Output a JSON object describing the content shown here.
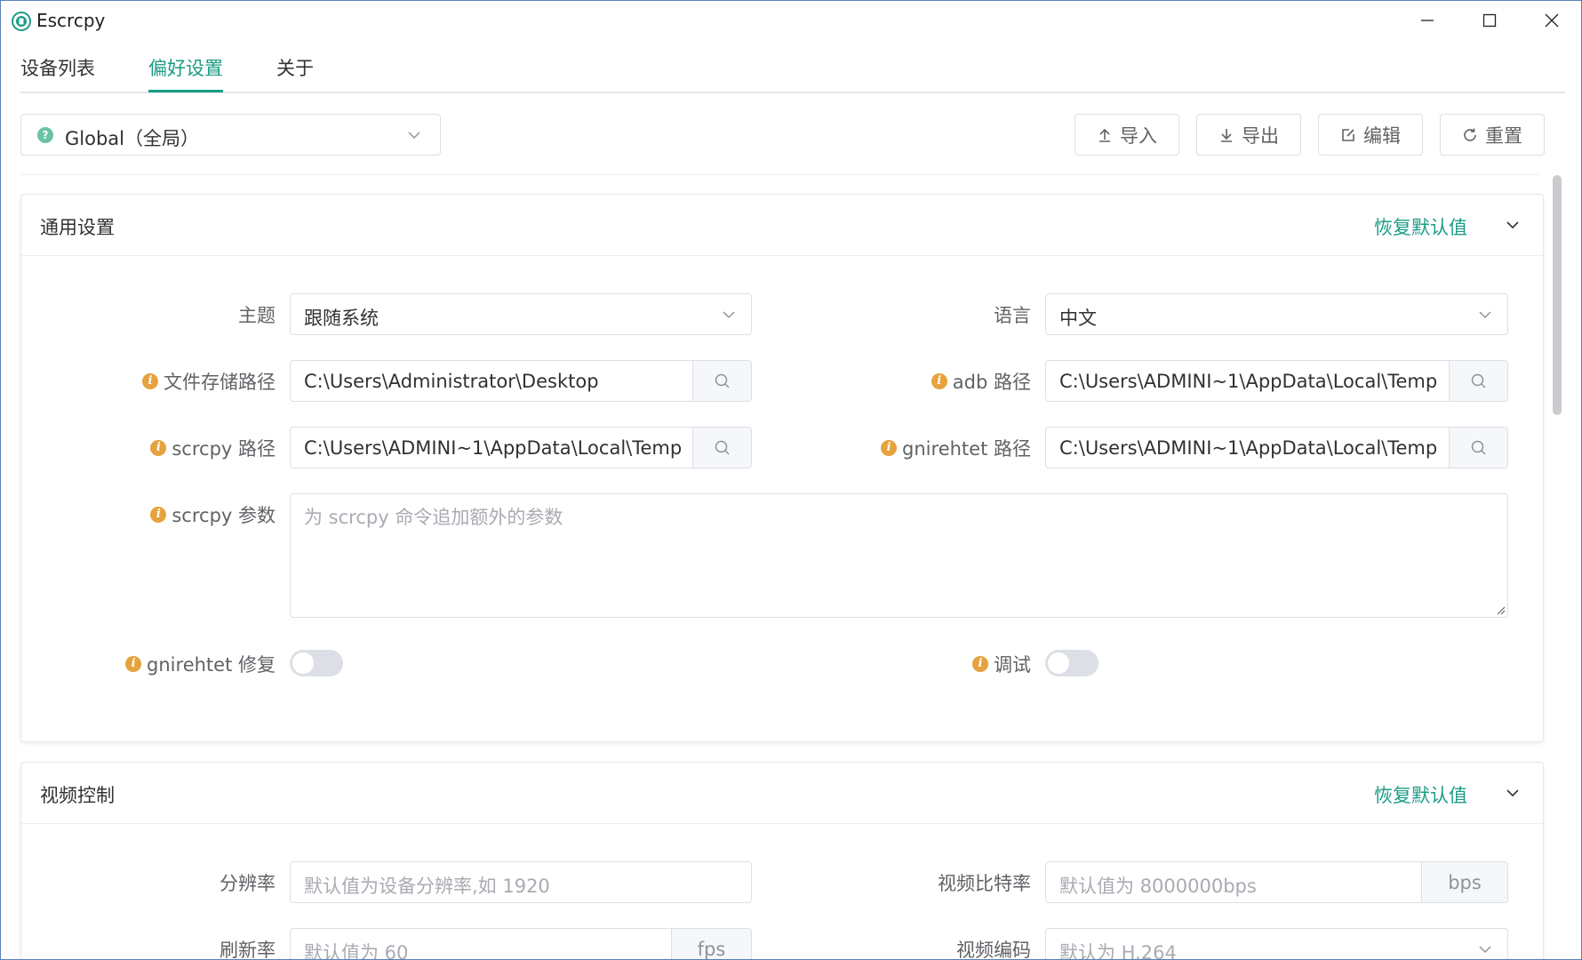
{
  "window": {
    "title": "Escrcpy"
  },
  "tabs": [
    {
      "label": "设备列表"
    },
    {
      "label": "偏好设置",
      "active": true
    },
    {
      "label": "关于"
    }
  ],
  "scope_select": {
    "value": "Global（全局）"
  },
  "toolbar": {
    "import_label": "导入",
    "export_label": "导出",
    "edit_label": "编辑",
    "reset_label": "重置"
  },
  "general": {
    "title": "通用设置",
    "reset_default": "恢复默认值",
    "theme": {
      "label": "主题",
      "value": "跟随系统"
    },
    "language": {
      "label": "语言",
      "value": "中文"
    },
    "file_path": {
      "label": "文件存储路径",
      "value": "C:\\Users\\Administrator\\Desktop"
    },
    "adb_path": {
      "label": "adb 路径",
      "value": "C:\\Users\\ADMINI~1\\AppData\\Local\\Temp"
    },
    "scrcpy_path": {
      "label": "scrcpy 路径",
      "value": "C:\\Users\\ADMINI~1\\AppData\\Local\\Temp"
    },
    "gnirehtet_path": {
      "label": "gnirehtet 路径",
      "value": "C:\\Users\\ADMINI~1\\AppData\\Local\\Temp"
    },
    "scrcpy_args": {
      "label": "scrcpy 参数",
      "placeholder": "为 scrcpy 命令追加额外的参数"
    },
    "gnirehtet_fix": {
      "label": "gnirehtet 修复",
      "on": false
    },
    "debug": {
      "label": "调试",
      "on": false
    }
  },
  "video": {
    "title": "视频控制",
    "reset_default": "恢复默认值",
    "resolution": {
      "label": "分辨率",
      "placeholder": "默认值为设备分辨率,如 1920"
    },
    "bitrate": {
      "label": "视频比特率",
      "placeholder": "默认值为 8000000bps",
      "unit": "bps"
    },
    "fps": {
      "label": "刷新率",
      "placeholder": "默认值为 60",
      "unit": "fps"
    },
    "codec": {
      "label": "视频编码",
      "placeholder": "默认为 H.264"
    }
  },
  "colors": {
    "accent": "#1b9c85",
    "info_icon": "#e6a23c",
    "border": "#dcdfe6"
  }
}
